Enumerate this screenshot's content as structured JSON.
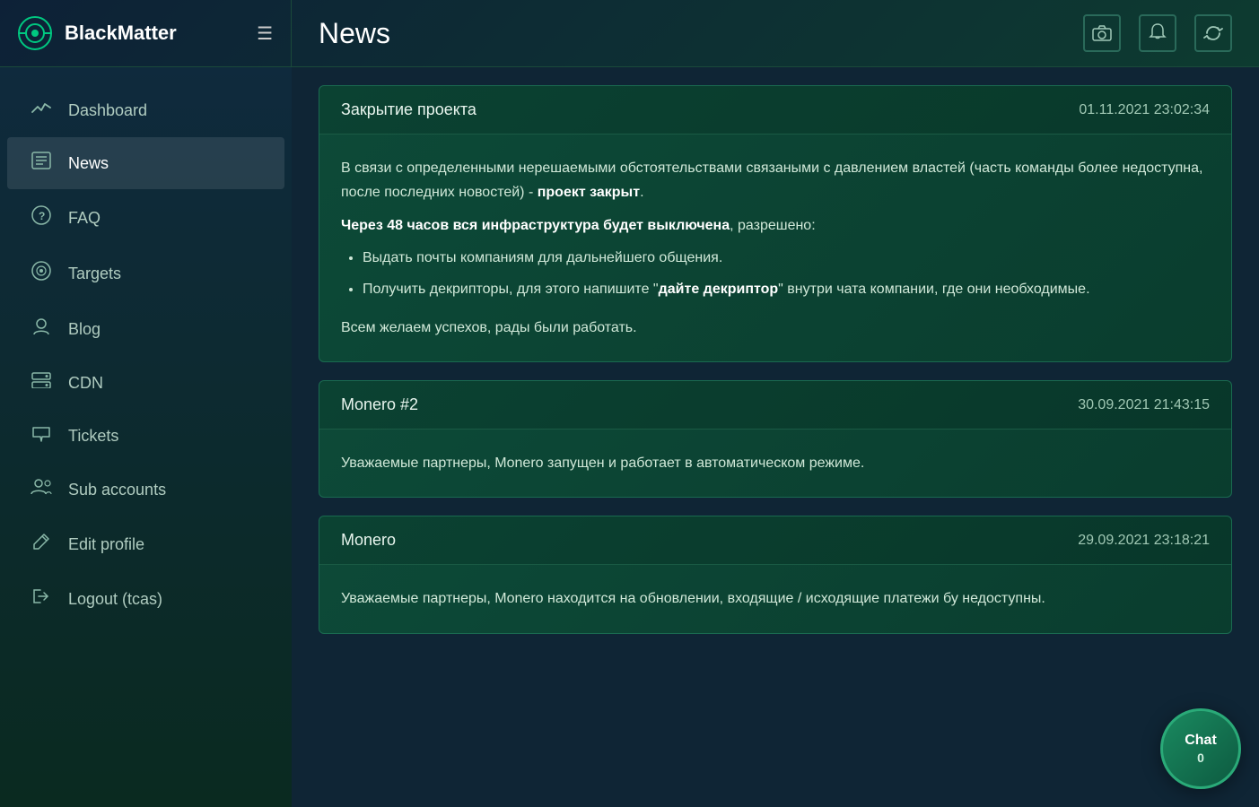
{
  "brand": {
    "name": "BlackMatter",
    "menu_icon": "☰"
  },
  "header": {
    "title": "News",
    "icons": {
      "camera": "⊡",
      "bell": "🔔",
      "refresh": "↻"
    }
  },
  "sidebar": {
    "items": [
      {
        "id": "dashboard",
        "label": "Dashboard",
        "icon": "📈"
      },
      {
        "id": "news",
        "label": "News",
        "icon": "📋",
        "active": true
      },
      {
        "id": "faq",
        "label": "FAQ",
        "icon": "❓"
      },
      {
        "id": "targets",
        "label": "Targets",
        "icon": "🎯"
      },
      {
        "id": "blog",
        "label": "Blog",
        "icon": "👤"
      },
      {
        "id": "cdn",
        "label": "CDN",
        "icon": "🖥"
      },
      {
        "id": "tickets",
        "label": "Tickets",
        "icon": "💬"
      },
      {
        "id": "subaccounts",
        "label": "Sub accounts",
        "icon": "👥"
      },
      {
        "id": "editprofile",
        "label": "Edit profile",
        "icon": "✏️"
      },
      {
        "id": "logout",
        "label": "Logout (tcas)",
        "icon": "🚪"
      }
    ]
  },
  "news": [
    {
      "id": "news1",
      "title": "Закрытие проекта",
      "date": "01.11.2021 23:02:34",
      "body_html": true,
      "body": "В связи с определенными нерешаемыми обстоятельствами связаными с давлением властей (часть команды более недоступна, после последних новостей) - проект закрыт.\nЧерез 48 часов вся инфраструктура будет выключена, разрешено:\n• Выдать почты компаниям для дальнейшего общения.\n• Получить декрипторы, для этого напишите \"дайте декриптор\" внутри чата компании, где они необходимые.\n\nВсем желаем успехов, рады были работать."
    },
    {
      "id": "news2",
      "title": "Monero #2",
      "date": "30.09.2021 21:43:15",
      "body": "Уважаемые партнеры, Monero запущен и работает в автоматическом режиме."
    },
    {
      "id": "news3",
      "title": "Monero",
      "date": "29.09.2021 23:18:21",
      "body": "Уважаемые партнеры, Monero находится на обновлении, входящие / исходящие платежи бу недоступны."
    }
  ],
  "chat": {
    "label": "Chat",
    "count": "0"
  }
}
